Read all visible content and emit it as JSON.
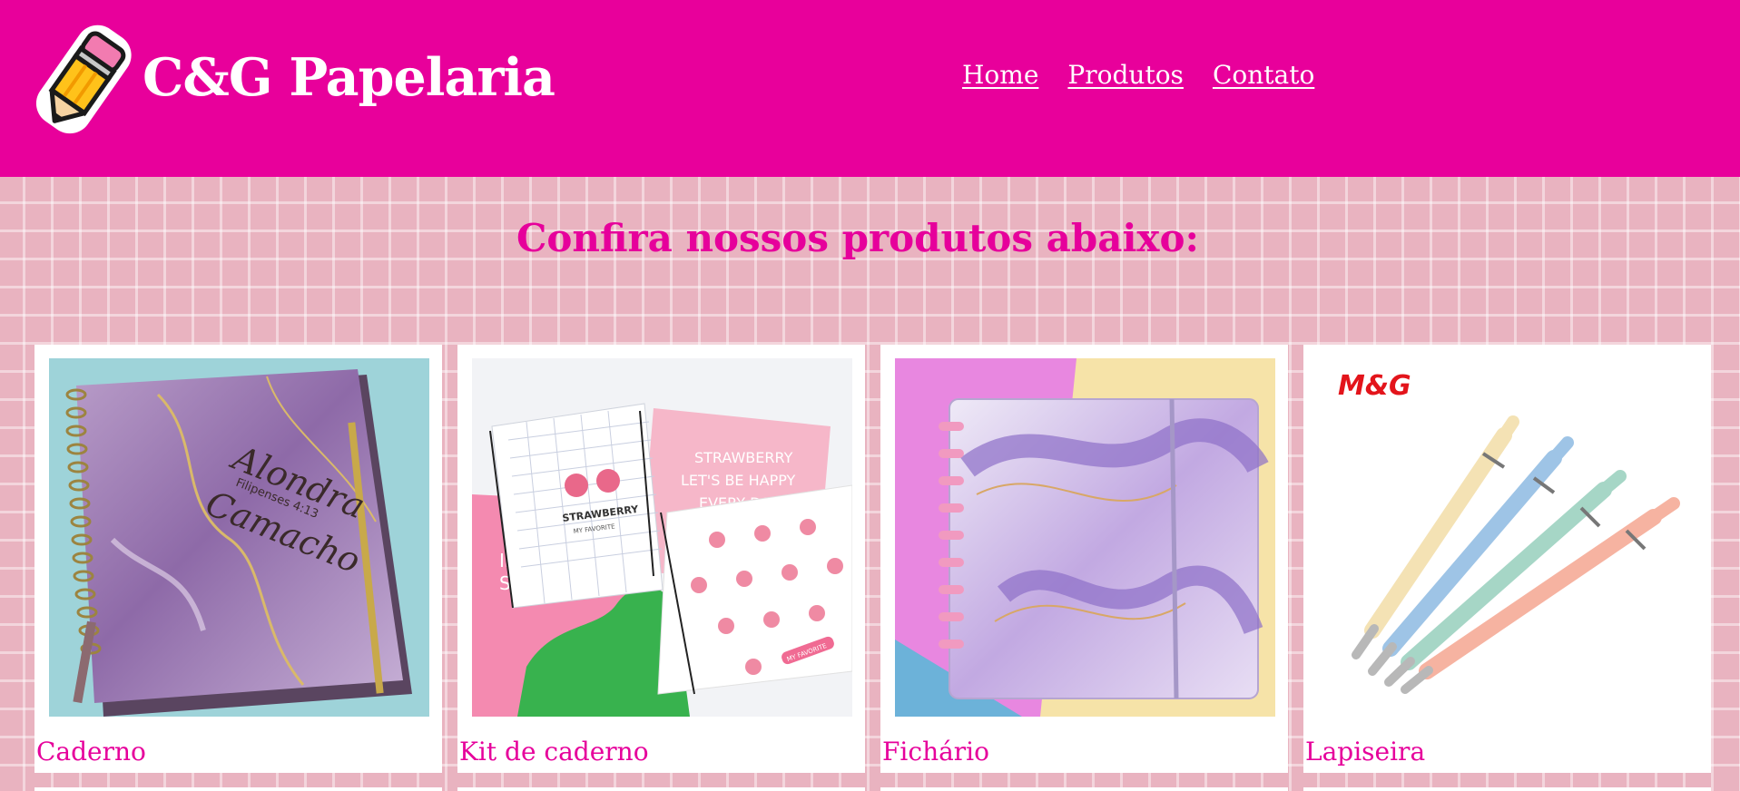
{
  "brand": {
    "name": "C&G Papelaria",
    "logo_icon": "pencil-icon"
  },
  "nav": [
    {
      "label": "Home"
    },
    {
      "label": "Produtos"
    },
    {
      "label": "Contato"
    }
  ],
  "section": {
    "title": "Confira nossos produtos abaixo:"
  },
  "products": [
    {
      "name": "Caderno",
      "image_text": [
        "Alondra",
        "Camacho",
        "Filipenses 4:13"
      ]
    },
    {
      "name": "Kit de caderno",
      "image_text": [
        "STRAWBERRY",
        "MY FAVORITE",
        "STRAWBERRY",
        "LET'S BE HAPPY",
        "EVERY DAY",
        "IN TH",
        "SUMM",
        "MY FAVORITE"
      ]
    },
    {
      "name": "Fichário"
    },
    {
      "name": "Lapiseira",
      "image_text": [
        "M&G"
      ]
    }
  ],
  "colors": {
    "header": "#e8009b",
    "accent": "#e6009b",
    "page_background": "#e9b3c0",
    "card": "#ffffff"
  }
}
